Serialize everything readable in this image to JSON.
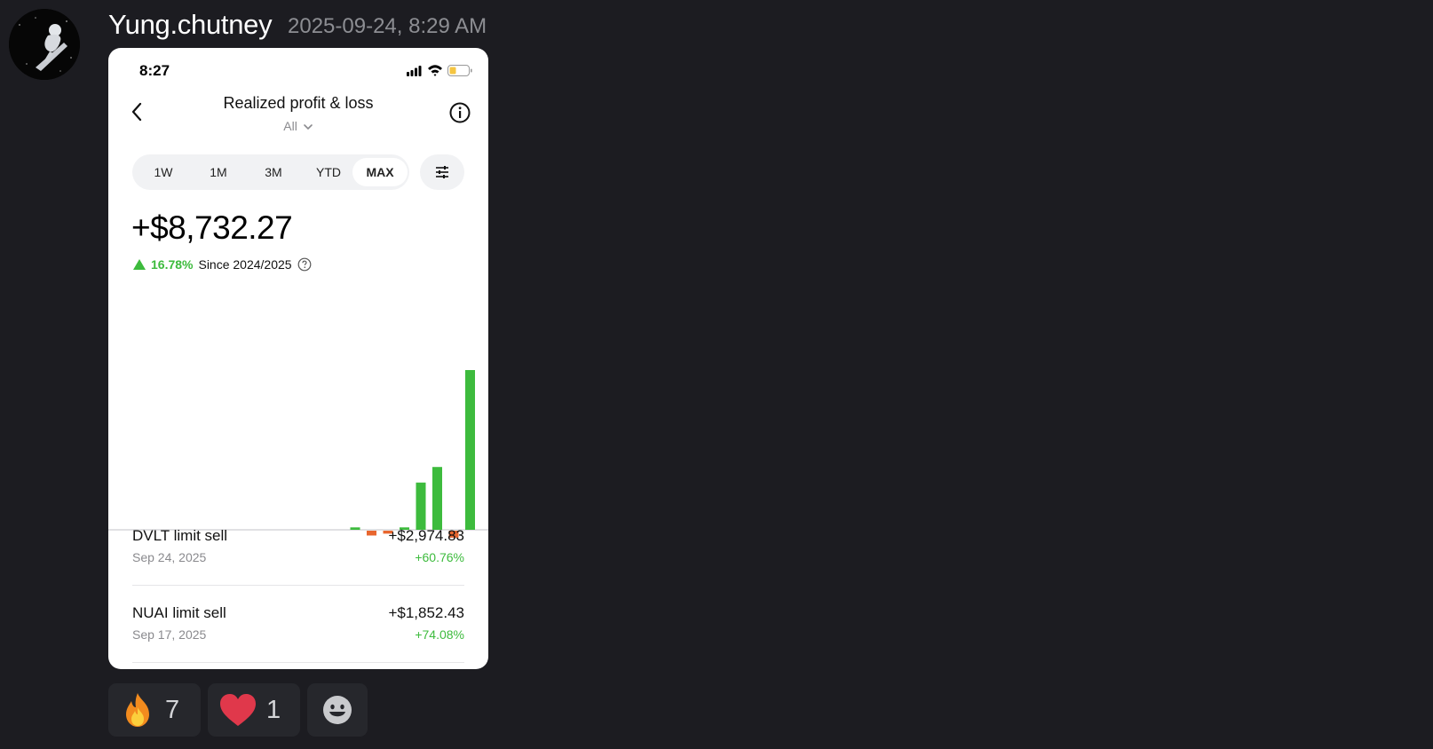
{
  "message": {
    "username": "Yung.chutney",
    "timestamp": "2025-09-24, 8:29 AM"
  },
  "phone": {
    "status_time": "8:27",
    "status_icons": [
      "signal-icon",
      "wifi-icon",
      "battery-icon"
    ],
    "title": "Realized profit & loss",
    "account_filter": "All",
    "tabs": [
      "1W",
      "1M",
      "3M",
      "YTD",
      "MAX"
    ],
    "active_tab": "MAX",
    "pnl_value": "+$8,732.27",
    "pnl_change_pct": "16.78%",
    "pnl_since": "Since 2024/2025",
    "trades": [
      {
        "name": "DVLT limit sell",
        "date": "Sep 24, 2025",
        "amount": "+$2,974.83",
        "pct": "+60.76%"
      },
      {
        "name": "NUAI limit sell",
        "date": "Sep 17, 2025",
        "amount": "+$1,852.43",
        "pct": "+74.08%"
      }
    ],
    "colors": {
      "positive": "#3dbb3d",
      "negative": "#e8662e"
    }
  },
  "chart_data": {
    "type": "bar",
    "values": [
      0,
      0,
      0,
      0,
      0,
      0,
      0,
      0,
      0,
      0,
      0,
      0,
      0,
      0,
      45,
      -90,
      -55,
      45,
      880,
      1170,
      -130,
      2975
    ]
  },
  "reactions": [
    {
      "icon": "fire-emoji-icon",
      "count": "7"
    },
    {
      "icon": "heart-emoji-icon",
      "count": "1"
    },
    {
      "icon": "add-reaction-icon",
      "count": ""
    }
  ]
}
